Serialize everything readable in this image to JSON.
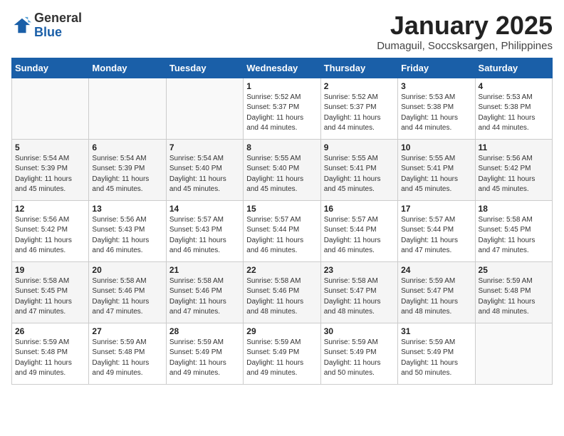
{
  "header": {
    "logo_general": "General",
    "logo_blue": "Blue",
    "title": "January 2025",
    "subtitle": "Dumaguil, Soccsksargen, Philippines"
  },
  "columns": [
    "Sunday",
    "Monday",
    "Tuesday",
    "Wednesday",
    "Thursday",
    "Friday",
    "Saturday"
  ],
  "weeks": [
    [
      {
        "num": "",
        "info": ""
      },
      {
        "num": "",
        "info": ""
      },
      {
        "num": "",
        "info": ""
      },
      {
        "num": "1",
        "info": "Sunrise: 5:52 AM\nSunset: 5:37 PM\nDaylight: 11 hours\nand 44 minutes."
      },
      {
        "num": "2",
        "info": "Sunrise: 5:52 AM\nSunset: 5:37 PM\nDaylight: 11 hours\nand 44 minutes."
      },
      {
        "num": "3",
        "info": "Sunrise: 5:53 AM\nSunset: 5:38 PM\nDaylight: 11 hours\nand 44 minutes."
      },
      {
        "num": "4",
        "info": "Sunrise: 5:53 AM\nSunset: 5:38 PM\nDaylight: 11 hours\nand 44 minutes."
      }
    ],
    [
      {
        "num": "5",
        "info": "Sunrise: 5:54 AM\nSunset: 5:39 PM\nDaylight: 11 hours\nand 45 minutes."
      },
      {
        "num": "6",
        "info": "Sunrise: 5:54 AM\nSunset: 5:39 PM\nDaylight: 11 hours\nand 45 minutes."
      },
      {
        "num": "7",
        "info": "Sunrise: 5:54 AM\nSunset: 5:40 PM\nDaylight: 11 hours\nand 45 minutes."
      },
      {
        "num": "8",
        "info": "Sunrise: 5:55 AM\nSunset: 5:40 PM\nDaylight: 11 hours\nand 45 minutes."
      },
      {
        "num": "9",
        "info": "Sunrise: 5:55 AM\nSunset: 5:41 PM\nDaylight: 11 hours\nand 45 minutes."
      },
      {
        "num": "10",
        "info": "Sunrise: 5:55 AM\nSunset: 5:41 PM\nDaylight: 11 hours\nand 45 minutes."
      },
      {
        "num": "11",
        "info": "Sunrise: 5:56 AM\nSunset: 5:42 PM\nDaylight: 11 hours\nand 45 minutes."
      }
    ],
    [
      {
        "num": "12",
        "info": "Sunrise: 5:56 AM\nSunset: 5:42 PM\nDaylight: 11 hours\nand 46 minutes."
      },
      {
        "num": "13",
        "info": "Sunrise: 5:56 AM\nSunset: 5:43 PM\nDaylight: 11 hours\nand 46 minutes."
      },
      {
        "num": "14",
        "info": "Sunrise: 5:57 AM\nSunset: 5:43 PM\nDaylight: 11 hours\nand 46 minutes."
      },
      {
        "num": "15",
        "info": "Sunrise: 5:57 AM\nSunset: 5:44 PM\nDaylight: 11 hours\nand 46 minutes."
      },
      {
        "num": "16",
        "info": "Sunrise: 5:57 AM\nSunset: 5:44 PM\nDaylight: 11 hours\nand 46 minutes."
      },
      {
        "num": "17",
        "info": "Sunrise: 5:57 AM\nSunset: 5:44 PM\nDaylight: 11 hours\nand 47 minutes."
      },
      {
        "num": "18",
        "info": "Sunrise: 5:58 AM\nSunset: 5:45 PM\nDaylight: 11 hours\nand 47 minutes."
      }
    ],
    [
      {
        "num": "19",
        "info": "Sunrise: 5:58 AM\nSunset: 5:45 PM\nDaylight: 11 hours\nand 47 minutes."
      },
      {
        "num": "20",
        "info": "Sunrise: 5:58 AM\nSunset: 5:46 PM\nDaylight: 11 hours\nand 47 minutes."
      },
      {
        "num": "21",
        "info": "Sunrise: 5:58 AM\nSunset: 5:46 PM\nDaylight: 11 hours\nand 47 minutes."
      },
      {
        "num": "22",
        "info": "Sunrise: 5:58 AM\nSunset: 5:46 PM\nDaylight: 11 hours\nand 48 minutes."
      },
      {
        "num": "23",
        "info": "Sunrise: 5:58 AM\nSunset: 5:47 PM\nDaylight: 11 hours\nand 48 minutes."
      },
      {
        "num": "24",
        "info": "Sunrise: 5:59 AM\nSunset: 5:47 PM\nDaylight: 11 hours\nand 48 minutes."
      },
      {
        "num": "25",
        "info": "Sunrise: 5:59 AM\nSunset: 5:48 PM\nDaylight: 11 hours\nand 48 minutes."
      }
    ],
    [
      {
        "num": "26",
        "info": "Sunrise: 5:59 AM\nSunset: 5:48 PM\nDaylight: 11 hours\nand 49 minutes."
      },
      {
        "num": "27",
        "info": "Sunrise: 5:59 AM\nSunset: 5:48 PM\nDaylight: 11 hours\nand 49 minutes."
      },
      {
        "num": "28",
        "info": "Sunrise: 5:59 AM\nSunset: 5:49 PM\nDaylight: 11 hours\nand 49 minutes."
      },
      {
        "num": "29",
        "info": "Sunrise: 5:59 AM\nSunset: 5:49 PM\nDaylight: 11 hours\nand 49 minutes."
      },
      {
        "num": "30",
        "info": "Sunrise: 5:59 AM\nSunset: 5:49 PM\nDaylight: 11 hours\nand 50 minutes."
      },
      {
        "num": "31",
        "info": "Sunrise: 5:59 AM\nSunset: 5:49 PM\nDaylight: 11 hours\nand 50 minutes."
      },
      {
        "num": "",
        "info": ""
      }
    ]
  ]
}
